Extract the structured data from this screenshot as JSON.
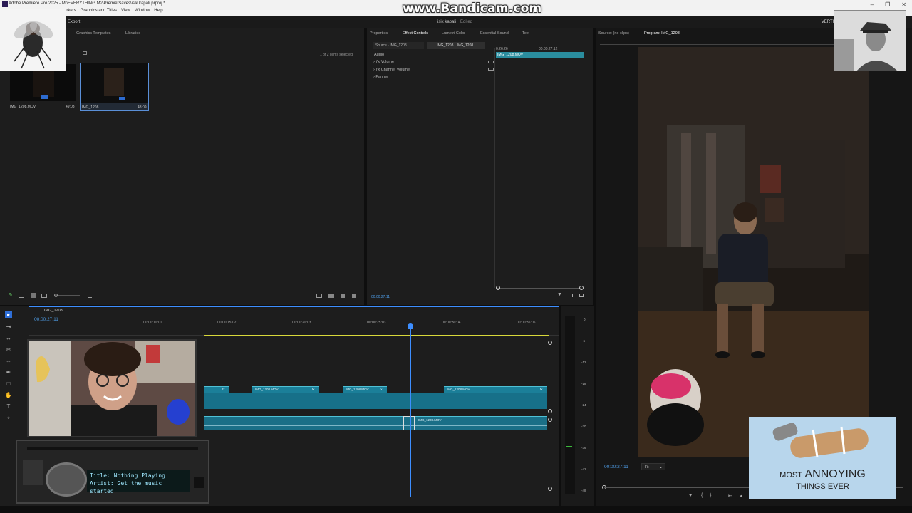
{
  "titlebar": {
    "title": "Adobe Premiere Pro 2025 - M:\\EVERYTHING M2\\Premie\\Saves\\isik kapali.prproj *",
    "menu": [
      "arkers",
      "Graphics and Titles",
      "View",
      "Window",
      "Help"
    ],
    "watermark": "www.Bandicam.com",
    "controls": [
      "–",
      "❐",
      "✕"
    ]
  },
  "header": {
    "export": "Export",
    "project_title": "isik kapali",
    "status": "Edited",
    "workspace": "VERTICAL"
  },
  "project": {
    "tabs": [
      "Graphics Templates",
      "Libraries"
    ],
    "selection": "1 of 2 items selected",
    "items": [
      {
        "name": "IMG_1208.MOV",
        "duration": "49:03"
      },
      {
        "name": "IMG_1208",
        "duration": "43:09"
      }
    ]
  },
  "effect_controls": {
    "tabs": [
      "Properties",
      "Effect Controls",
      "Lumetri Color",
      "Essential Sound",
      "Text"
    ],
    "source_label": "Source · IMG_1208...",
    "sequence_label": "IMG_1208 · IMG_1208...",
    "section": "Audio",
    "effects": [
      "Volume",
      "Channel Volume",
      "Panner"
    ],
    "time_left": "0:26:26",
    "time_right": "00:00:27:12",
    "clip_name": "IMG_1208.MOV",
    "current_time": "00:00:27:11"
  },
  "program": {
    "source_tab": "Source: (no clips)",
    "program_tab": "Program: IMG_1208",
    "timecode": "00:00:27:11",
    "fit": "Fit"
  },
  "timeline": {
    "sequence_name": "IMG_1208",
    "timecode": "00:00:27:11",
    "ruler": [
      "00:00:10:01",
      "00:00:15:02",
      "00:00:20:03",
      "00:00:25:03",
      "00:00:30:04",
      "00:00:35:05"
    ],
    "video_clips": [
      "IMG_1208.MOV",
      "IMG_1208.MOV",
      "IMG_1208.MOV"
    ],
    "audio_clip": "IMG_1208.MOV",
    "fx": "fx"
  },
  "meters": {
    "scale": [
      "0",
      "-6",
      "-12",
      "-18",
      "-24",
      "-30",
      "-36",
      "-42",
      "-48"
    ]
  },
  "music_player": {
    "title_line": "Title: Nothing Playing",
    "artist_line": "Artist: Get the music started"
  },
  "ad": {
    "line1_prefix": "MOST",
    "line1_main": "ANNOYING",
    "line2": "THINGS EVER"
  },
  "colors": {
    "clip": "#1b7f99",
    "playhead": "#3d8eff",
    "accent": "#2a8d9e"
  }
}
